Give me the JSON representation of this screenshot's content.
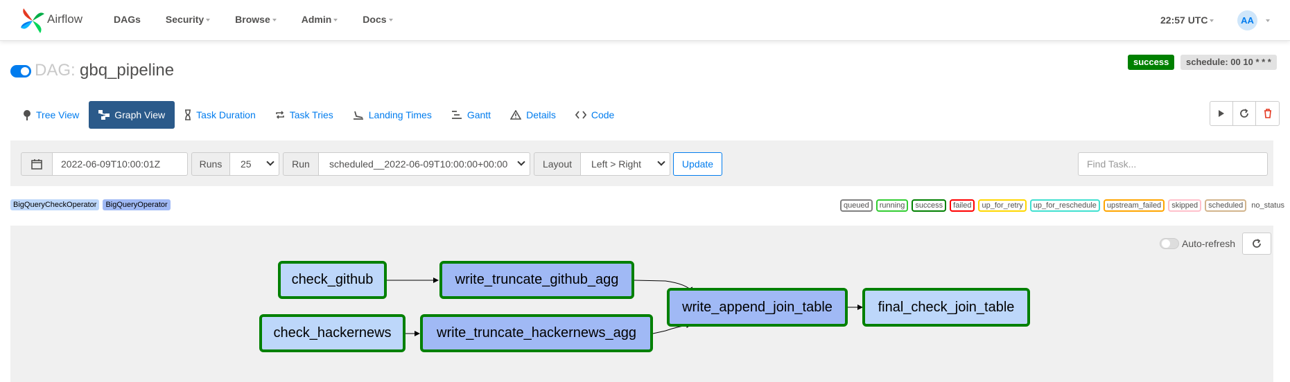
{
  "brand": {
    "name": "Airflow"
  },
  "nav": {
    "items": [
      {
        "label": "DAGs",
        "dropdown": false
      },
      {
        "label": "Security",
        "dropdown": true
      },
      {
        "label": "Browse",
        "dropdown": true
      },
      {
        "label": "Admin",
        "dropdown": true
      },
      {
        "label": "Docs",
        "dropdown": true
      }
    ],
    "clock": "22:57 UTC",
    "user_initials": "AA"
  },
  "dag": {
    "prefix": "DAG:",
    "name": "gbq_pipeline",
    "status": "success",
    "schedule": "schedule: 00 10 * * *",
    "active": true
  },
  "tabs": [
    {
      "label": "Tree View",
      "icon": "tree-icon",
      "active": false
    },
    {
      "label": "Graph View",
      "icon": "graph-icon",
      "active": true
    },
    {
      "label": "Task Duration",
      "icon": "hourglass-icon",
      "active": false
    },
    {
      "label": "Task Tries",
      "icon": "repeat-icon",
      "active": false
    },
    {
      "label": "Landing Times",
      "icon": "landing-icon",
      "active": false
    },
    {
      "label": "Gantt",
      "icon": "gantt-icon",
      "active": false
    },
    {
      "label": "Details",
      "icon": "warning-icon",
      "active": false
    },
    {
      "label": "Code",
      "icon": "code-icon",
      "active": false
    }
  ],
  "filters": {
    "base_date": "2022-06-09T10:00:01Z",
    "runs_label": "Runs",
    "runs_value": "25",
    "run_label": "Run",
    "run_value": "scheduled__2022-06-09T10:00:00+00:00",
    "layout_label": "Layout",
    "layout_value": "Left > Right",
    "update_label": "Update",
    "find_placeholder": "Find Task..."
  },
  "operator_legend": [
    {
      "label": "BigQueryCheckOperator",
      "color": "#bdd7fa"
    },
    {
      "label": "BigQueryOperator",
      "color": "#a0b9f5"
    }
  ],
  "state_legend": [
    {
      "label": "queued",
      "color": "#808080"
    },
    {
      "label": "running",
      "color": "#32cd32"
    },
    {
      "label": "success",
      "color": "#008000"
    },
    {
      "label": "failed",
      "color": "#ff0000"
    },
    {
      "label": "up_for_retry",
      "color": "#ffd700"
    },
    {
      "label": "up_for_reschedule",
      "color": "#40e0d0"
    },
    {
      "label": "upstream_failed",
      "color": "#ffa500"
    },
    {
      "label": "skipped",
      "color": "#ffc0cb"
    },
    {
      "label": "scheduled",
      "color": "#d2b48c"
    },
    {
      "label": "no_status",
      "color": null
    }
  ],
  "graph": {
    "autorefresh_label": "Auto-refresh",
    "nodes": [
      {
        "id": "check_github",
        "label": "check_github",
        "operator": "BigQueryCheckOperator",
        "state": "success"
      },
      {
        "id": "write_truncate_github_agg",
        "label": "write_truncate_github_agg",
        "operator": "BigQueryOperator",
        "state": "success"
      },
      {
        "id": "check_hackernews",
        "label": "check_hackernews",
        "operator": "BigQueryCheckOperator",
        "state": "success"
      },
      {
        "id": "write_truncate_hackernews_agg",
        "label": "write_truncate_hackernews_agg",
        "operator": "BigQueryOperator",
        "state": "success"
      },
      {
        "id": "write_append_join_table",
        "label": "write_append_join_table",
        "operator": "BigQueryOperator",
        "state": "success"
      },
      {
        "id": "final_check_join_table",
        "label": "final_check_join_table",
        "operator": "BigQueryCheckOperator",
        "state": "success"
      }
    ],
    "edges": [
      [
        "check_github",
        "write_truncate_github_agg"
      ],
      [
        "check_hackernews",
        "write_truncate_hackernews_agg"
      ],
      [
        "write_truncate_github_agg",
        "write_append_join_table"
      ],
      [
        "write_truncate_hackernews_agg",
        "write_append_join_table"
      ],
      [
        "write_append_join_table",
        "final_check_join_table"
      ]
    ]
  }
}
